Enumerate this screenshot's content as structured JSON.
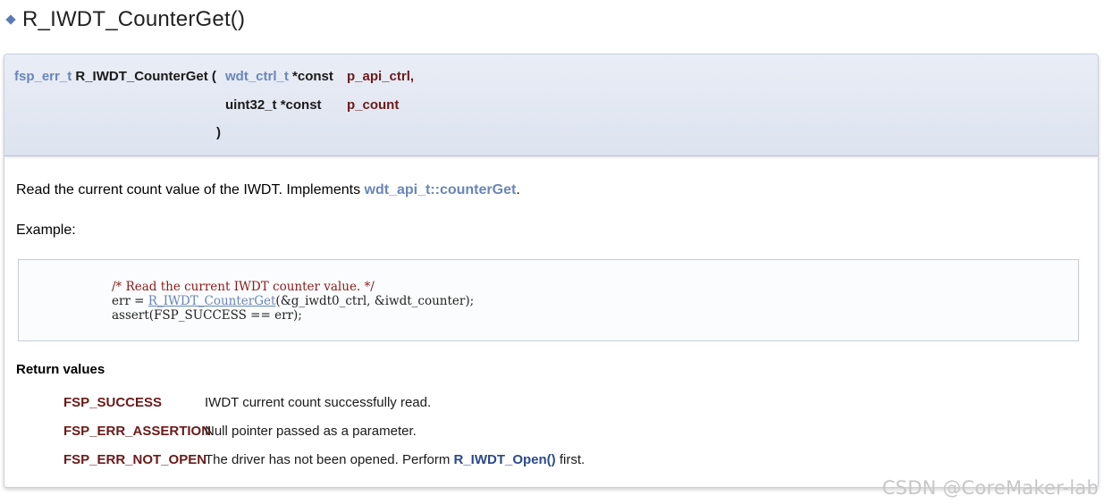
{
  "page_title": "R_IWDT_CounterGet()",
  "prototype": {
    "return_type": "fsp_err_t",
    "function_name": "R_IWDT_CounterGet",
    "open_paren": "(",
    "params": [
      {
        "type": "wdt_ctrl_t",
        "qualifier": "*const",
        "name": "p_api_ctrl,"
      },
      {
        "type": "uint32_t",
        "qualifier": "*const",
        "name": "p_count"
      }
    ],
    "close_paren": ")"
  },
  "description": {
    "text": "Read the current count value of the IWDT. Implements ",
    "link": "wdt_api_t::counterGet",
    "suffix": "."
  },
  "example_label": "Example:",
  "code": {
    "comment": "/* Read the current IWDT counter value. */",
    "line2_prefix": "err = ",
    "line2_link": "R_IWDT_CounterGet",
    "line2_suffix": "(&g_iwdt0_ctrl, &iwdt_counter);",
    "line3": "assert(FSP_SUCCESS == err);"
  },
  "return_values": {
    "title": "Return values",
    "rows": [
      {
        "code": "FSP_SUCCESS",
        "text": "IWDT current count successfully read."
      },
      {
        "code": "FSP_ERR_ASSERTION",
        "text": "Null pointer passed as a parameter."
      },
      {
        "code": "FSP_ERR_NOT_OPEN",
        "text": "The driver has not been opened. Perform ",
        "link": "R_IWDT_Open()",
        "suffix": " first."
      }
    ]
  },
  "watermark": "CSDN @CoreMaker-lab",
  "colors": {
    "link": "#6a86b8",
    "param": "#6b1a1a",
    "header_bg": "#e4e9f3"
  },
  "icons": {
    "title_bullet": "diamond-icon"
  }
}
